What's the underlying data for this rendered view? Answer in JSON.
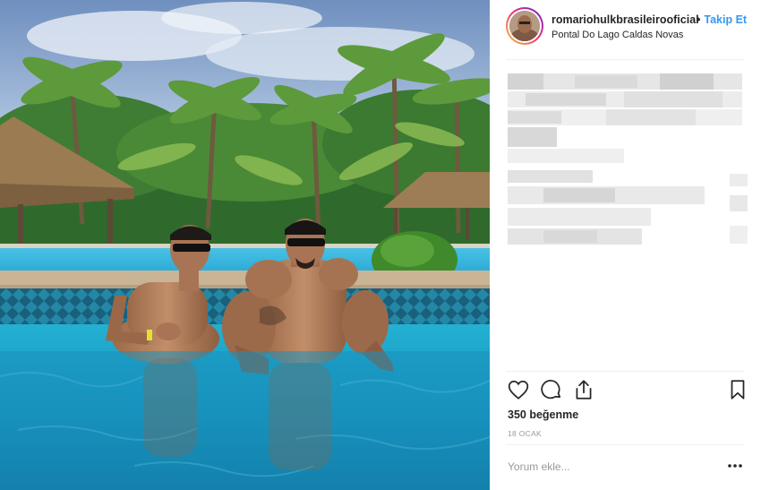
{
  "post": {
    "username": "romariohulkbrasileirooficial",
    "separator": "•",
    "follow_label": "Takip Et",
    "location": "Pontal Do Lago Caldas Novas",
    "likes": "350 beğenme",
    "date": "18 OCAK",
    "comment_placeholder": "Yorum ekle..."
  },
  "icons": {
    "like": "heart-icon",
    "comment": "speech-bubble-icon",
    "share": "share-icon",
    "save": "bookmark-icon",
    "more": "more-dots-icon"
  },
  "colors": {
    "link": "#3897f0",
    "text": "#262626",
    "muted": "#999999",
    "divider": "#efefef"
  }
}
